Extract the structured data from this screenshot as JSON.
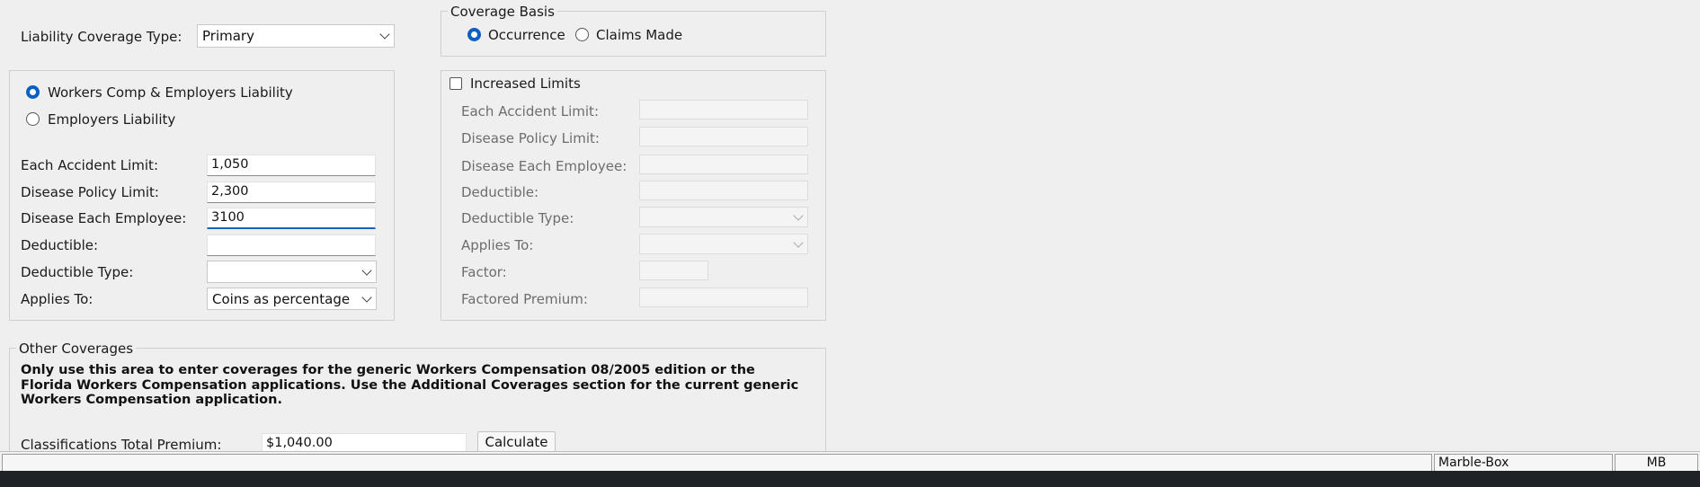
{
  "liability_coverage_type": {
    "label": "Liability Coverage Type:",
    "value": "Primary"
  },
  "coverage_basis": {
    "legend": "Coverage Basis",
    "options": [
      {
        "label": "Occurrence",
        "selected": true
      },
      {
        "label": "Claims Made",
        "selected": false
      }
    ]
  },
  "coverage_type": {
    "options": [
      {
        "label": "Workers Comp & Employers Liability",
        "selected": true
      },
      {
        "label": "Employers Liability",
        "selected": false
      }
    ]
  },
  "limits": {
    "each_accident": {
      "label": "Each Accident Limit:",
      "value": "1,050"
    },
    "disease_policy": {
      "label": "Disease Policy Limit:",
      "value": "2,300"
    },
    "disease_each_employee": {
      "label": "Disease Each Employee:",
      "value": "3100"
    },
    "deductible": {
      "label": "Deductible:",
      "value": ""
    },
    "deductible_type": {
      "label": "Deductible Type:",
      "value": ""
    },
    "applies_to": {
      "label": "Applies To:",
      "value": "Coins as percentage"
    }
  },
  "increased_limits": {
    "checkbox_label": "Increased Limits",
    "checked": false,
    "fields": {
      "each_accident": "Each Accident Limit:",
      "disease_policy": "Disease Policy Limit:",
      "disease_each_employee": "Disease Each Employee:",
      "deductible": "Deductible:",
      "deductible_type": "Deductible Type:",
      "applies_to": "Applies To:",
      "factor": "Factor:",
      "factored_premium": "Factored Premium:"
    }
  },
  "other_coverages": {
    "legend": "Other Coverages",
    "note_line1": "Only use this area to enter coverages for the generic Workers Compensation 08/2005 edition or the",
    "note_line2": "Florida Workers Compensation applications.  Use the Additional Coverages section for the current generic",
    "note_line3": "Workers Compensation application.",
    "total_premium_label": "Classifications Total Premium:",
    "total_premium_value": "$1,040.00",
    "calculate_label": "Calculate"
  },
  "status_bar": {
    "left": "",
    "server": "Marble-Box",
    "user": "MB"
  },
  "colors": {
    "accent": "#0a5fc4",
    "focus_underline": "#1565c0",
    "background": "#efefef"
  }
}
